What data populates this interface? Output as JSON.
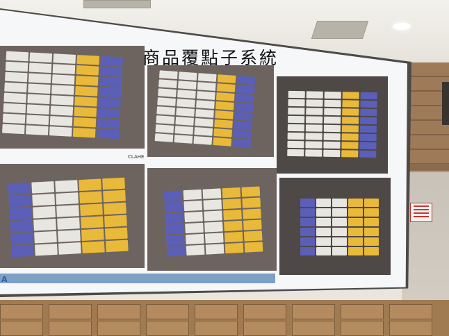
{
  "slide": {
    "title": "商品覆點子系統",
    "label_clahe": "CLAHE",
    "logo_fragment": "A"
  },
  "colors": {
    "ticket_white": "#e8e6e0",
    "ticket_yellow": "#e9b93a",
    "ticket_blue": "#5b5fb8",
    "background_dark": "#6d6460"
  }
}
